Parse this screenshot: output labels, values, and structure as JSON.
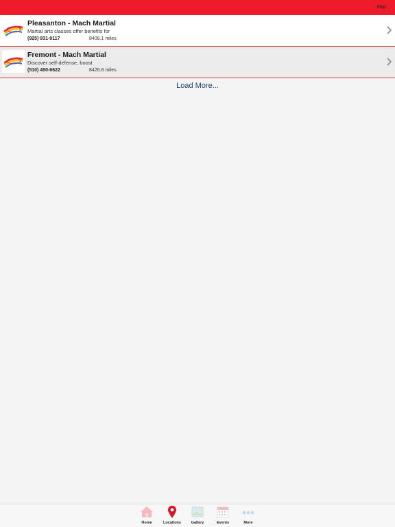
{
  "header": {
    "map_label": "Map"
  },
  "locations": [
    {
      "title": "Pleasanton - Mach Martial",
      "description": "Martial arts classes offer benefits for",
      "phone": "(925) 931-9117",
      "distance": "8408.1 miles"
    },
    {
      "title": "Fremont - Mach Martial",
      "description": "Discover self-defense, boost",
      "phone": "(510) 490-6622",
      "distance": "8426.8 miles"
    }
  ],
  "load_more_label": "Load More...",
  "tabs": [
    {
      "label": "Home",
      "icon": "home-icon"
    },
    {
      "label": "Locations",
      "icon": "location-pin-icon"
    },
    {
      "label": "Gallery",
      "icon": "gallery-icon"
    },
    {
      "label": "Events",
      "icon": "calendar-icon"
    },
    {
      "label": "More",
      "icon": "more-dots-icon"
    }
  ],
  "colors": {
    "header": "#ee1b2a",
    "active_tab": "#d9142b",
    "inactive_tab": "#f4b6c0",
    "link": "#1d3f6e"
  }
}
